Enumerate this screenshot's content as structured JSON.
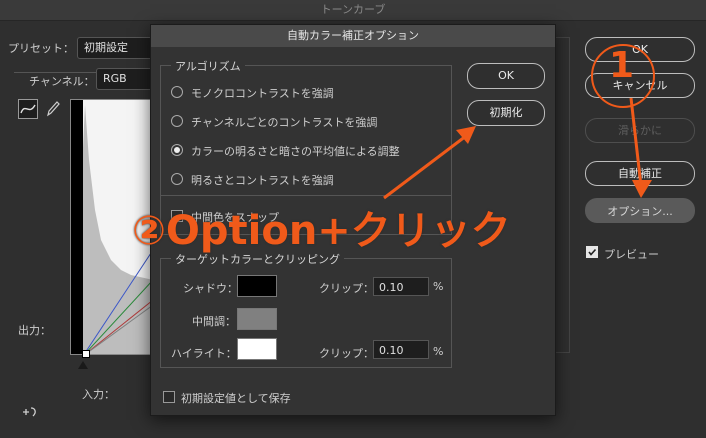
{
  "window": {
    "title": "トーンカーブ"
  },
  "main": {
    "preset_label": "プリセット：",
    "preset_value": "初期設定",
    "channel_label": "チャンネル：",
    "channel_value": "RGB",
    "output_label": "出力：",
    "input_label": "入力："
  },
  "side_buttons": {
    "ok": "OK",
    "cancel": "キャンセル",
    "smooth": "滑らかに",
    "auto": "自動補正",
    "options": "オプション...",
    "preview": "プレビュー"
  },
  "dialog": {
    "title": "自動カラー補正オプション",
    "algorithm": {
      "group_label": "アルゴリズム",
      "options": [
        {
          "label": "モノクロコントラストを強調",
          "selected": false
        },
        {
          "label": "チャンネルごとのコントラストを強調",
          "selected": false
        },
        {
          "label": "カラーの明るさと暗さの平均値による調整",
          "selected": true
        },
        {
          "label": "明るさとコントラストを強調",
          "selected": false
        }
      ],
      "snap_label": "中間色をスナップ"
    },
    "ok_button": "OK",
    "reset_button": "初期化",
    "target": {
      "group_label": "ターゲットカラーとクリッピング",
      "shadow_label": "シャドウ：",
      "midtone_label": "中間調：",
      "highlight_label": "ハイライト：",
      "clip_label": "クリップ：",
      "shadow_clip": "0.10",
      "highlight_clip": "0.10",
      "percent": "%"
    },
    "save_default": "初期設定値として保存"
  },
  "annotations": {
    "step1": "1",
    "step2": "②Option+クリック"
  },
  "colors": {
    "accent": "#f05a1a",
    "shadow_swatch": "#000000",
    "midtone_swatch": "#808080",
    "highlight_swatch": "#ffffff"
  }
}
